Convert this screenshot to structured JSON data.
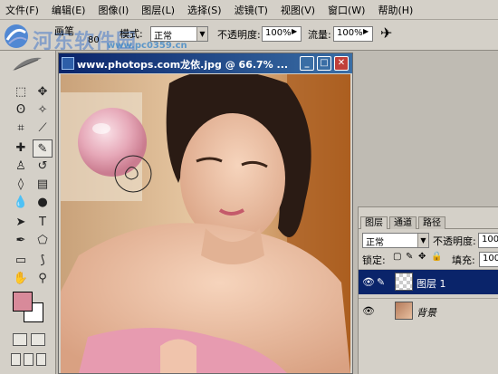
{
  "menubar": {
    "items": [
      "文件(F)",
      "编辑(E)",
      "图像(I)",
      "图层(L)",
      "选择(S)",
      "滤镜(T)",
      "视图(V)",
      "窗口(W)",
      "帮助(H)"
    ]
  },
  "options": {
    "brush_label": "画笔",
    "brush_size": "80",
    "mode_label": "模式:",
    "mode_value": "正常",
    "opacity_label": "不透明度:",
    "opacity_value": "100%",
    "flow_label": "流量:",
    "flow_value": "100%"
  },
  "watermark": {
    "site_name": "河东软件园",
    "url": "www.pc0359.cn"
  },
  "document": {
    "title": "www.photops.com龙依.jpg @ 66.7% ...",
    "minimize": "_",
    "maximize": "□",
    "close": "✕"
  },
  "tools": {
    "icons": [
      "marquee-icon",
      "move-icon",
      "lasso-icon",
      "magic-wand-icon",
      "crop-icon",
      "slice-icon",
      "healing-brush-icon",
      "brush-icon",
      "clone-stamp-icon",
      "history-brush-icon",
      "eraser-icon",
      "gradient-icon",
      "blur-icon",
      "dodge-icon",
      "path-select-icon",
      "type-icon",
      "pen-icon",
      "shape-icon",
      "notes-icon",
      "eyedropper-icon",
      "hand-icon",
      "zoom-icon"
    ],
    "foreground_color": "#d88a9a",
    "background_color": "#ffffff"
  },
  "layers_panel": {
    "tabs": [
      "图层",
      "通道",
      "路径"
    ],
    "blend_mode": "正常",
    "opacity_label": "不透明度:",
    "opacity_value": "100",
    "lock_label": "锁定:",
    "fill_label": "填充:",
    "fill_value": "100",
    "layers": [
      {
        "name": "图层 1",
        "selected": true
      },
      {
        "name": "背景",
        "selected": false
      }
    ]
  }
}
